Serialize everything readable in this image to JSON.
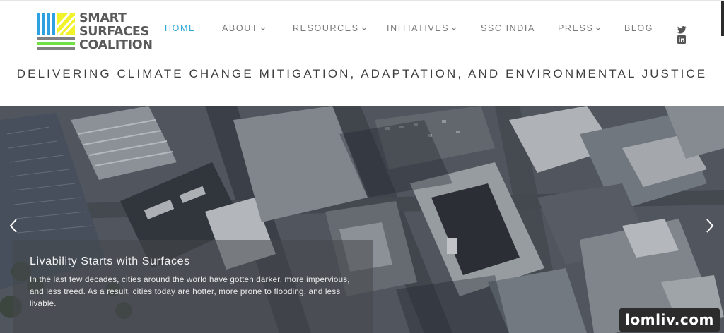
{
  "brand": {
    "name_lines": [
      "SMART",
      "SURFACES",
      "COALITION"
    ],
    "colors": {
      "gray": "#808080",
      "yellow": "#f2f22a",
      "green": "#6fe046",
      "blue": "#2fa0e0",
      "text": "#5a5a5a"
    }
  },
  "nav": {
    "items": [
      {
        "label": "HOME",
        "active": true,
        "dropdown": false
      },
      {
        "label": "ABOUT",
        "active": false,
        "dropdown": true
      },
      {
        "label": "RESOURCES",
        "active": false,
        "dropdown": true
      },
      {
        "label": "INITIATIVES",
        "active": false,
        "dropdown": true
      },
      {
        "label": "SSC INDIA",
        "active": false,
        "dropdown": false
      },
      {
        "label": "PRESS",
        "active": false,
        "dropdown": true
      },
      {
        "label": "BLOG",
        "active": false,
        "dropdown": false
      }
    ],
    "active_color": "#35a9d6",
    "social": [
      "twitter-icon",
      "linkedin-icon"
    ]
  },
  "tagline": "DELIVERING CLIMATE CHANGE MITIGATION, ADAPTATION, AND ENVIRONMENTAL JUSTICE",
  "hero": {
    "caption_title": "Livability Starts with Surfaces",
    "caption_body": "In the last few decades, cities around the world have gotten darker, more impervious, and less treed. As a result, cities today are hotter, more prone to flooding, and less livable.",
    "prev_icon": "chevron-left-icon",
    "next_icon": "chevron-right-icon"
  },
  "watermark": "lomliv.com"
}
